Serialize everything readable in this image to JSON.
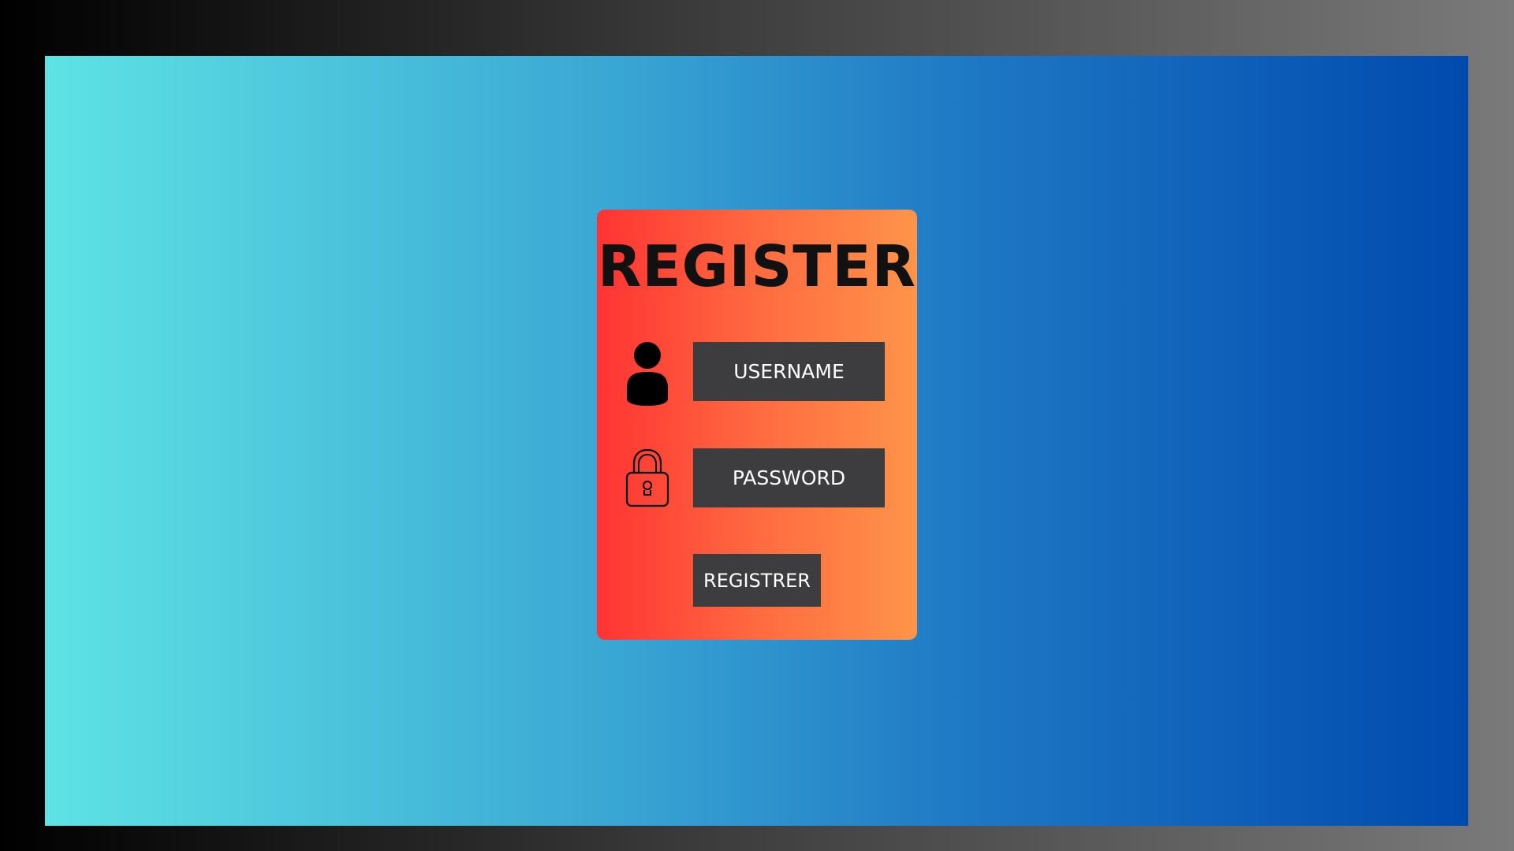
{
  "form": {
    "title": "REGISTER",
    "username_label": "USERNAME",
    "password_label": "PASSWORD",
    "submit_label": "REGISTRER"
  },
  "icons": {
    "username": "user-icon",
    "password": "lock-icon"
  },
  "colors": {
    "card_gradient_start": "#ff3333",
    "card_gradient_end": "#ff944a",
    "field_background": "#3d3d3f",
    "background_gradient_start": "#5ee3e4",
    "background_gradient_end": "#004aae"
  }
}
